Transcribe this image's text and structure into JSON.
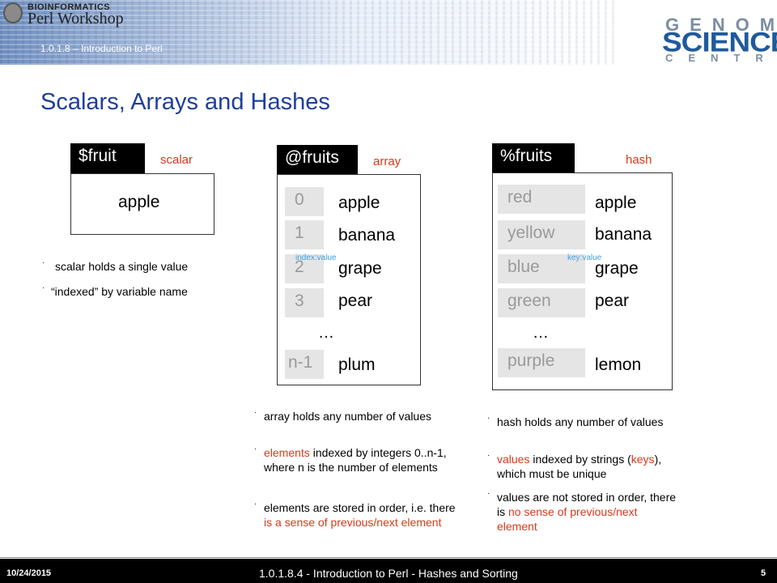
{
  "header": {
    "logo_line1": "BIOINFORMATICS",
    "logo_line2": "Perl Workshop",
    "subtitle": "1.0.1.8 – Introduction to Perl",
    "brand_genome": "GENOME",
    "brand_sciences": "SCIENCES",
    "brand_centre": "CENTRE"
  },
  "slide": {
    "title": "Scalars, Arrays and Hashes"
  },
  "scalar": {
    "name": "$fruit",
    "kind": "scalar",
    "value": "apple",
    "bullets": [
      "scalar holds a single value",
      "“indexed” by variable name"
    ]
  },
  "array": {
    "name": "@fruits",
    "kind": "array",
    "indices": [
      "0",
      "1",
      "2",
      "3",
      "n-1"
    ],
    "values": [
      "apple",
      "banana",
      "grape",
      "pear",
      "plum"
    ],
    "ellipsis": "…",
    "note": "index:value",
    "bullets": {
      "b1": "array holds any number of values",
      "b2_red": "elements",
      "b2_rest": " indexed by integers 0..n-1, where n is the number of elements",
      "b3_plain": "elements are stored in order, i.e. there ",
      "b3_red": "is a sense of previous/next element"
    }
  },
  "hash": {
    "name": "%fruits",
    "kind": "hash",
    "keys": [
      "red",
      "yellow",
      "blue",
      "green",
      "purple"
    ],
    "values": [
      "apple",
      "banana",
      "grape",
      "pear",
      "lemon"
    ],
    "ellipsis": "…",
    "note": "key:value",
    "bullets": {
      "b1": "hash holds any number of values",
      "b2_red1": "values",
      "b2_mid1": " indexed by strings (",
      "b2_red2": "keys",
      "b2_rest": "), which must be unique",
      "b3_plain": "values are not stored in order, there is ",
      "b3_red": "no sense of previous/next element"
    }
  },
  "footer": {
    "date": "10/24/2015",
    "center": "1.0.1.8.4 - Introduction to Perl - Hashes and Sorting",
    "page": "5"
  },
  "colors": {
    "title_blue": "#1f3f99",
    "accent_red": "#d9391b",
    "note_blue": "#3aa0e6",
    "cell_gray": "#e5e5e5"
  }
}
